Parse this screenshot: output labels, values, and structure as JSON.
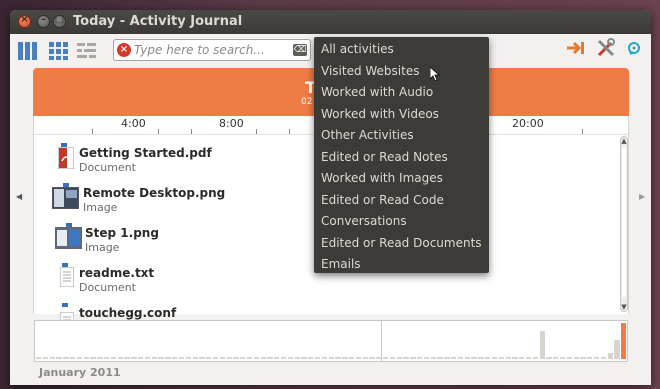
{
  "window": {
    "title": "Today - Activity Journal"
  },
  "toolbar": {
    "search_placeholder": "Type here to search...",
    "view_icons": [
      "grid-view-icon",
      "thumbnail-view-icon",
      "timeline-view-icon"
    ],
    "right_icons": [
      "export-arrow-icon",
      "preferences-tools-icon",
      "help-icon"
    ]
  },
  "header": {
    "day_label_partial": "T",
    "date_partial": "02"
  },
  "timeline": {
    "hours": [
      "4:00",
      "8:00",
      "20:00"
    ]
  },
  "items": [
    {
      "name": "Getting Started.pdf",
      "type": "Document",
      "icon": "pdf-file-icon"
    },
    {
      "name": "Remote Desktop.png",
      "type": "Image",
      "icon": "image-thumbnail-icon"
    },
    {
      "name": "Step 1.png",
      "type": "Image",
      "icon": "image-thumbnail-icon"
    },
    {
      "name": "readme.txt",
      "type": "Document",
      "icon": "text-file-icon"
    },
    {
      "name": "touchegg.conf",
      "type": "",
      "icon": "text-file-icon"
    }
  ],
  "filter_menu": {
    "items": [
      "All activities",
      "Visited Websites",
      "Worked with Audio",
      "Worked with Videos",
      "Other Activities",
      "Edited or Read Notes",
      "Worked with Images",
      "Edited or Read Code",
      "Conversations",
      "Edited or Read Documents",
      "Emails"
    ]
  },
  "histogram": {
    "month_label": "January 2011",
    "activity_levels": [
      0.05,
      0.05,
      0.05,
      0.05,
      0.05,
      0.05,
      0.05,
      0.05,
      0.05,
      0.05,
      0.05,
      0.05,
      0.05,
      0.05,
      0.05,
      0.05,
      0.05,
      0.05,
      0.05,
      0.05,
      0.05,
      0.05,
      0.05,
      0.05,
      0.05,
      0.05,
      0.05,
      0.05,
      0.05,
      0.05,
      0.05,
      0.05,
      0.05,
      0.05,
      0.05,
      0.05,
      0.05,
      0.05,
      0.05,
      0.05,
      0.05,
      0.05,
      0.05,
      0.05,
      0.05,
      0.05,
      0.05,
      0.05,
      0.05,
      0.05,
      0.05,
      0.05,
      0.05,
      0.05,
      0.05,
      0.05,
      0.05,
      0.05,
      0.05,
      0.05,
      0.05,
      0.05,
      0.05,
      0.05,
      0.05,
      0.05,
      0.05,
      0.05,
      0.05,
      0.05,
      0.05,
      0.05,
      0.05,
      0.05,
      0.75,
      0.05,
      0.05,
      0.05,
      0.05,
      0.05,
      0.05,
      0.05,
      0.05,
      0.05,
      0.15,
      0.5,
      0.95
    ]
  },
  "colors": {
    "accent": "#ef7c45",
    "menu_bg": "#3c3b37",
    "titlebar": "#3c3b37"
  }
}
